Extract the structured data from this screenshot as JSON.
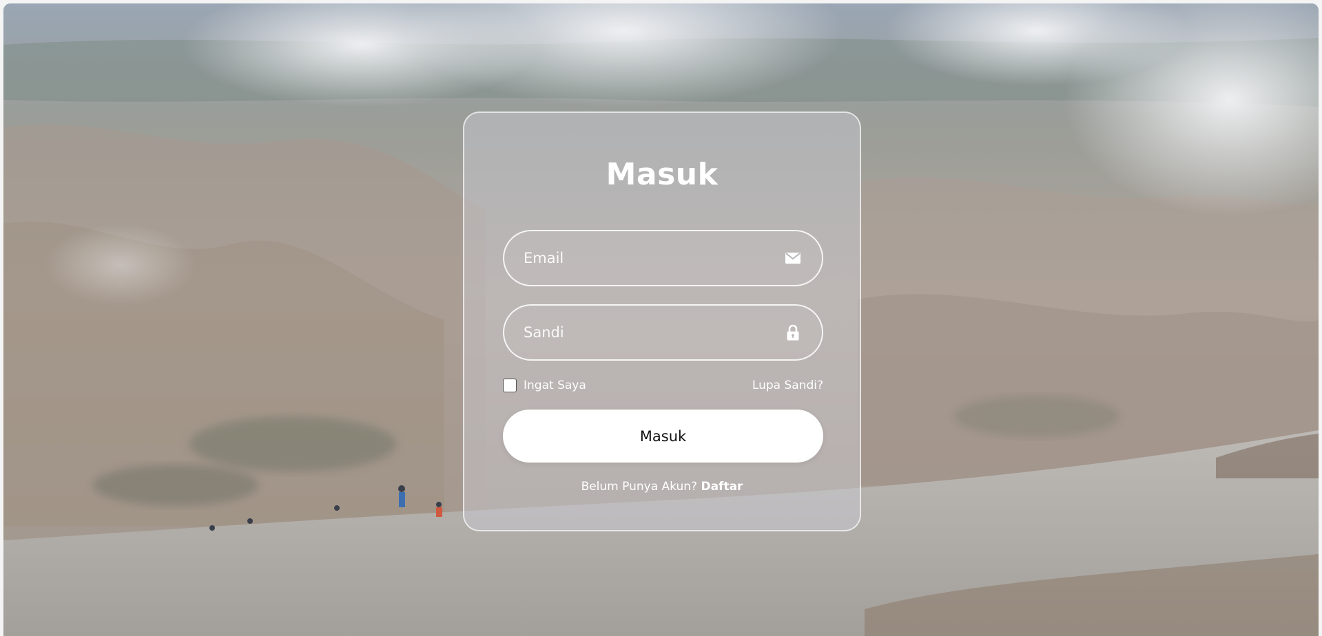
{
  "login": {
    "title": "Masuk",
    "email_placeholder": "Email",
    "password_placeholder": "Sandi",
    "remember_label": "Ingat Saya",
    "forgot_label": "Lupa Sandi?",
    "submit_label": "Masuk",
    "register_prompt": "Belum Punya Akun?",
    "register_link": "Daftar"
  },
  "icons": {
    "email": "envelope-icon",
    "password": "lock-icon"
  },
  "colors": {
    "card_border": "#ffffff",
    "button_bg": "#ffffff",
    "button_text": "#111111",
    "text": "#ffffff"
  }
}
